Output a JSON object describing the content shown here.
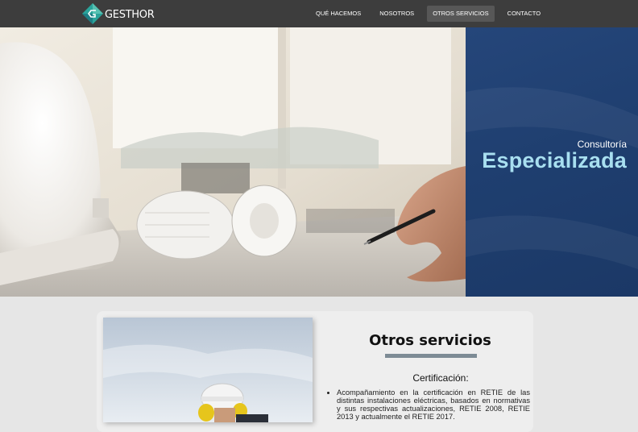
{
  "nav": {
    "brand": "GESTHOR",
    "items": [
      {
        "label": "QUÉ HACEMOS",
        "active": false
      },
      {
        "label": "NOSOTROS",
        "active": false
      },
      {
        "label": "OTROS SERVICIOS",
        "active": true
      },
      {
        "label": "CONTACTO",
        "active": false
      }
    ]
  },
  "hero": {
    "subtitle": "Consultoría",
    "title": "Especializada"
  },
  "section": {
    "title": "Otros servicios",
    "certification": {
      "heading": "Certificación:",
      "bullets": [
        "Acompañamiento en la certificación en RETIE de las distintas instalaciones eléctricas, basados en normativas y sus respectivas actualizaciones, RETIE 2008, RETIE 2013 y actualmente el RETIE 2017."
      ]
    }
  },
  "colors": {
    "nav_bg": "#3d3d3d",
    "panel_blue": "#1f3f70",
    "accent_teal": "#a8dff0",
    "rule_gray": "#7d8b95"
  }
}
